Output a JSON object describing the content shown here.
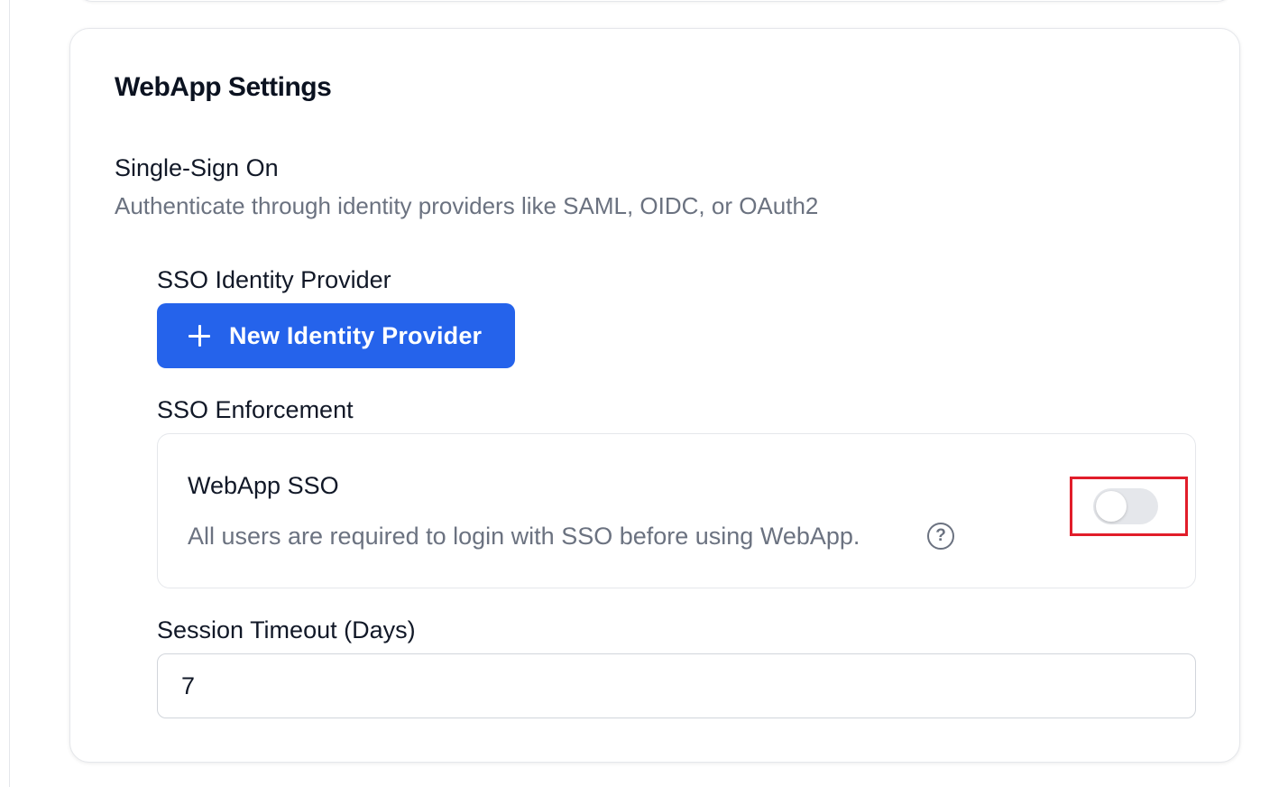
{
  "card": {
    "title": "WebApp Settings"
  },
  "sso_section": {
    "title": "Single-Sign On",
    "description": "Authenticate through identity providers like SAML, OIDC, or OAuth2"
  },
  "identity_provider": {
    "label": "SSO Identity Provider",
    "button_label": "New Identity Provider",
    "button_icon": "plus-icon"
  },
  "enforcement": {
    "label": "SSO Enforcement",
    "title": "WebApp SSO",
    "description": "All users are required to login with SSO before using WebApp.",
    "help_icon": "help-circle-icon",
    "help_glyph": "?",
    "toggle_on": false
  },
  "session_timeout": {
    "label": "Session Timeout (Days)",
    "value": "7"
  },
  "colors": {
    "primary": "#2563eb",
    "highlight": "#e11d2a",
    "muted_text": "#6b7280",
    "toggle_off": "#e5e7eb"
  }
}
